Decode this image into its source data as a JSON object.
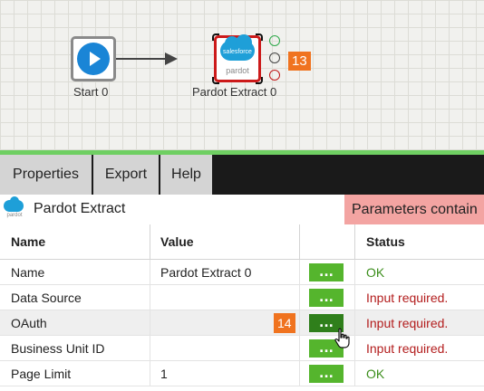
{
  "canvas": {
    "start_node_label": "Start 0",
    "pardot_node_label": "Pardot Extract 0",
    "pardot_logo_text": "salesforce",
    "pardot_logo_sub": "pardot",
    "callout_a": "13",
    "callout_b": "14"
  },
  "tabs": [
    {
      "label": "Properties",
      "selected": true
    },
    {
      "label": "Export",
      "selected": false
    },
    {
      "label": "Help",
      "selected": false
    }
  ],
  "component": {
    "icon_text": "pardot",
    "title": "Pardot Extract",
    "banner": "Parameters contain"
  },
  "table": {
    "headers": {
      "name": "Name",
      "value": "Value",
      "action": "",
      "status": "Status"
    },
    "rows": [
      {
        "name": "Name",
        "value": "Pardot Extract 0",
        "button": "...",
        "status": "OK",
        "status_type": "ok"
      },
      {
        "name": "Data Source",
        "value": "",
        "button": "...",
        "status": "Input required.",
        "status_type": "required"
      },
      {
        "name": "OAuth",
        "value": "",
        "button": "...",
        "status": "Input required.",
        "status_type": "required"
      },
      {
        "name": "Business Unit ID",
        "value": "",
        "button": "...",
        "status": "Input required.",
        "status_type": "required"
      },
      {
        "name": "Page Limit",
        "value": "1",
        "button": "...",
        "status": "OK",
        "status_type": "ok"
      }
    ]
  },
  "colors": {
    "accent_green": "#55b52d",
    "error_red": "#cc1a1a",
    "banner_pink": "#f3a4a2",
    "callout_orange": "#f0731f",
    "status_ok": "#3c8e1c",
    "status_required": "#b31d1d"
  }
}
